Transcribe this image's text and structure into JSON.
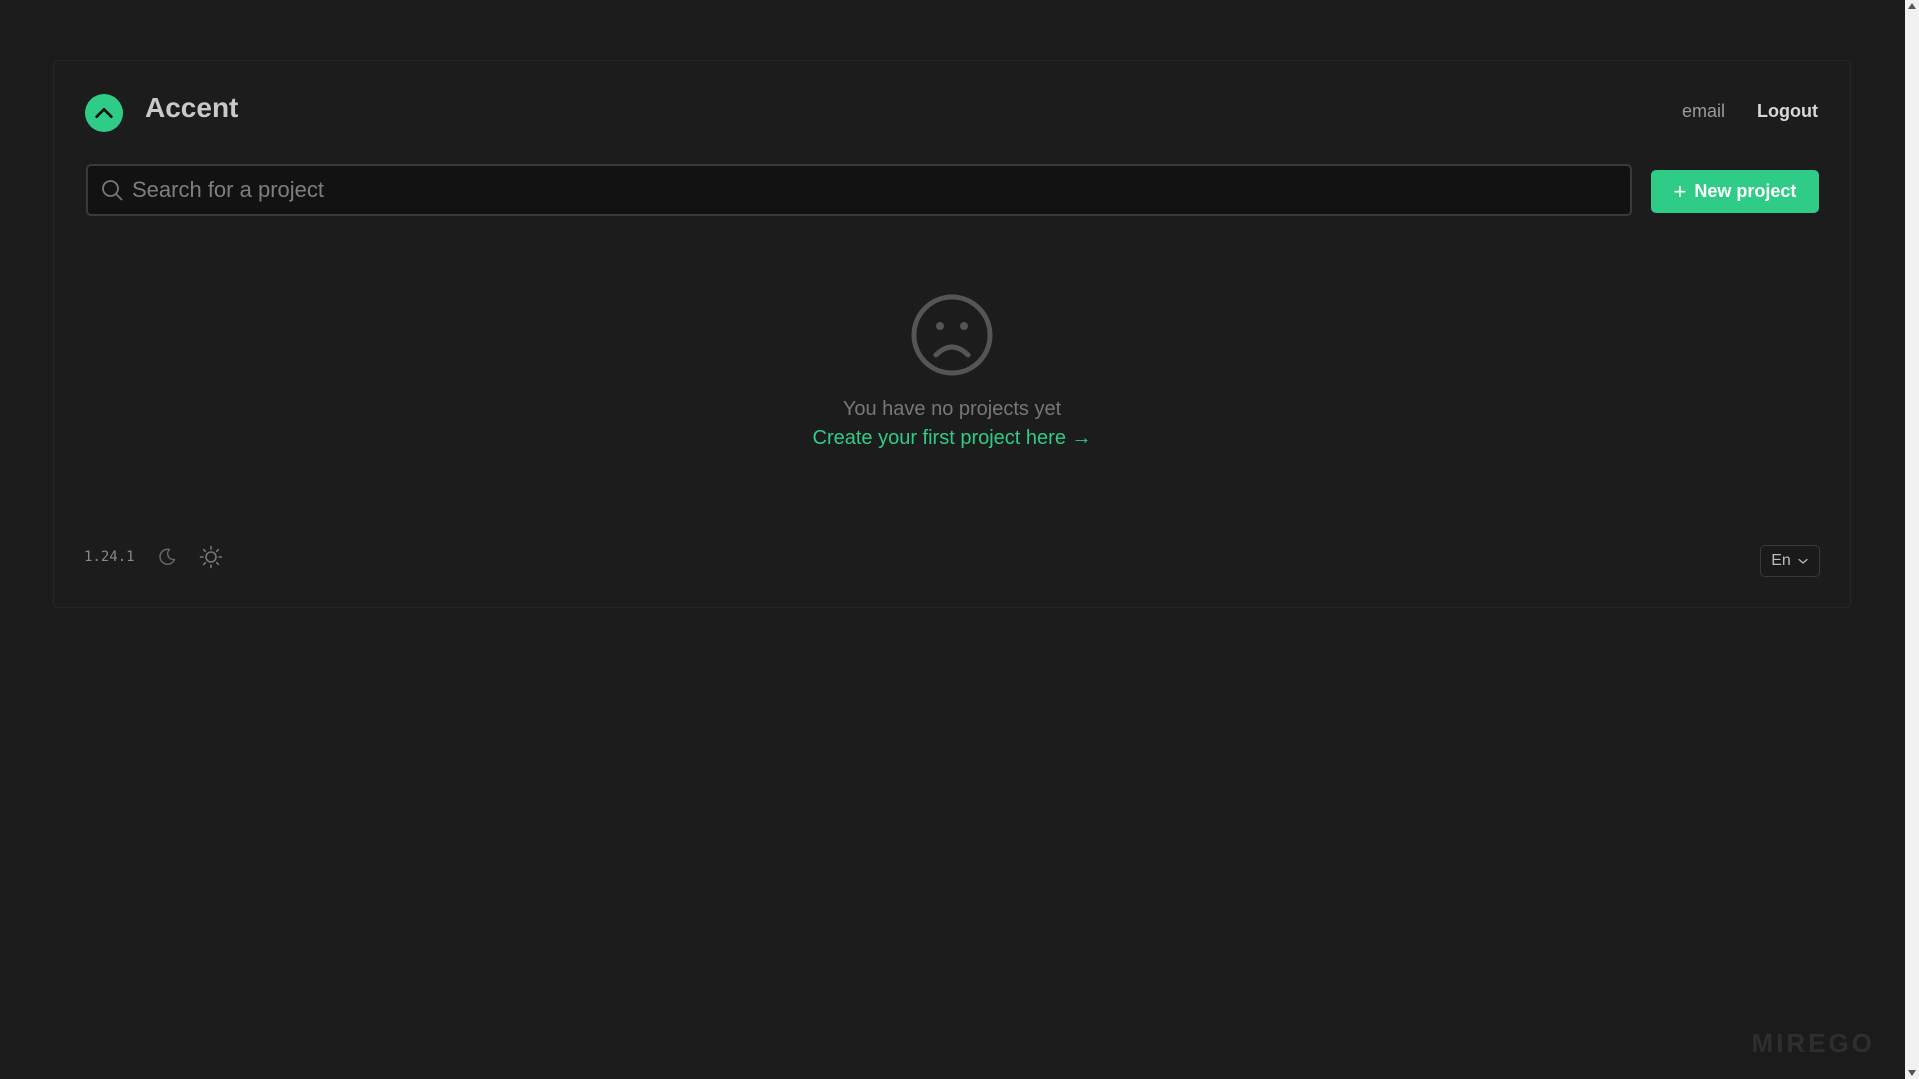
{
  "app": {
    "title": "Accent"
  },
  "header": {
    "email_label": "email",
    "logout_label": "Logout"
  },
  "search": {
    "placeholder": "Search for a project",
    "value": ""
  },
  "actions": {
    "new_project_label": "New project"
  },
  "empty_state": {
    "message": "You have no projects yet",
    "link_label": "Create your first project here →"
  },
  "footer": {
    "version": "1.24.1",
    "language": "En"
  },
  "watermark": "MIREGO",
  "icons": {
    "logo": "chevron-up-icon",
    "search": "search-icon",
    "add": "plus-icon",
    "empty": "sad-face-icon",
    "dark_mode": "moon-icon",
    "light_mode": "sun-icon",
    "dropdown": "chevron-down-icon"
  },
  "colors": {
    "accent": "#2ecc87",
    "background": "#1b1b1b"
  }
}
